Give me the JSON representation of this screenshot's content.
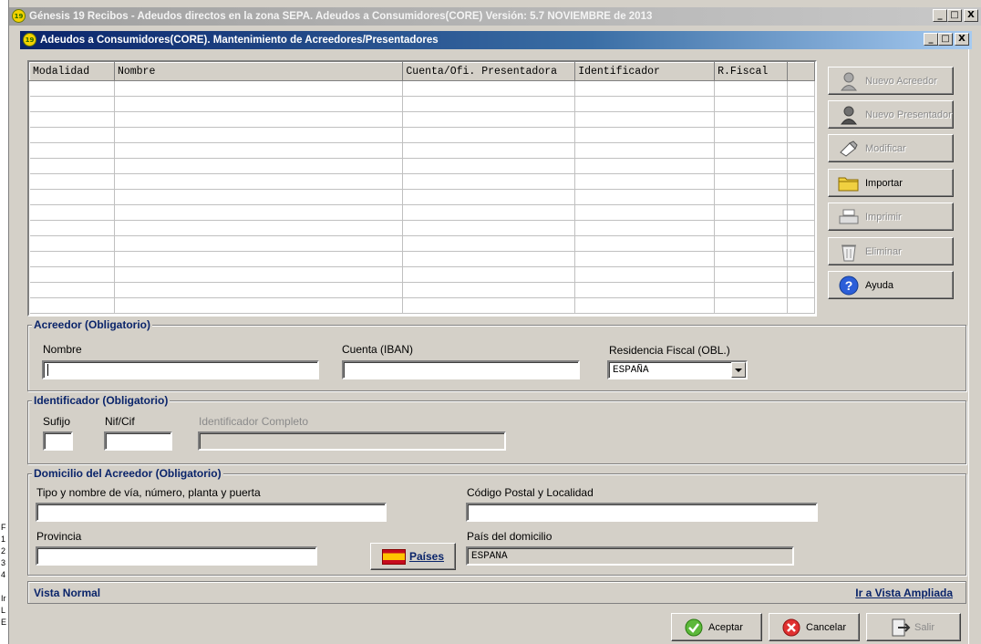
{
  "outer_window": {
    "title": "Génesis 19 Recibos - Adeudos directos en la zona SEPA. Adeudos a Consumidores(CORE) Versión: 5.7 NOVIEMBRE de 2013",
    "icon_text": "19",
    "min": "_",
    "max": "□",
    "close": "X"
  },
  "inner_window": {
    "title": "Adeudos a Consumidores(CORE). Mantenimiento de Acreedores/Presentadores",
    "icon_text": "19",
    "min": "_",
    "max": "□",
    "close": "X"
  },
  "grid": {
    "columns": [
      "Modalidad",
      "Nombre",
      "Cuenta/Ofi. Presentadora",
      "Identificador",
      "R.Fiscal",
      ""
    ]
  },
  "side_buttons": [
    {
      "label": "Nuevo Acreedor",
      "enabled": false,
      "icon": "person-icon"
    },
    {
      "label": "Nuevo Presentador",
      "enabled": false,
      "icon": "person-dark-icon"
    },
    {
      "label": "Modificar",
      "enabled": false,
      "icon": "edit-icon"
    },
    {
      "label": "Importar",
      "enabled": true,
      "icon": "folder-icon"
    },
    {
      "label": "Imprimir",
      "enabled": false,
      "icon": "printer-icon"
    },
    {
      "label": "Eliminar",
      "enabled": false,
      "icon": "trash-icon"
    },
    {
      "label": "Ayuda",
      "enabled": true,
      "icon": "help-icon"
    }
  ],
  "acreedor": {
    "title": "Acreedor (Obligatorio)",
    "nombre_label": "Nombre",
    "nombre_value": "",
    "cuenta_label": "Cuenta (IBAN)",
    "cuenta_value": "",
    "residencia_label": "Residencia Fiscal (OBL.)",
    "residencia_value": "ESPAÑA"
  },
  "identificador": {
    "title": "Identificador (Obligatorio)",
    "sufijo_label": "Sufijo",
    "nif_label": "Nif/Cif",
    "completo_label": "Identificador Completo"
  },
  "domicilio": {
    "title": "Domicilio del Acreedor (Obligatorio)",
    "via_label": "Tipo y nombre de vía, número, planta y puerta",
    "cp_label": "Código Postal y Localidad",
    "provincia_label": "Provincia",
    "paises_button": "Países",
    "pais_label": "País del domicilio",
    "pais_value": "ESPANA"
  },
  "status": {
    "left": "Vista Normal",
    "right": "Ir a Vista Ampliada"
  },
  "footer_buttons": {
    "aceptar": "Aceptar",
    "cancelar": "Cancelar",
    "salir": "Salir"
  },
  "left_strip_text": [
    "F",
    "1",
    "2",
    "3",
    "4",
    "",
    "Ir",
    "L",
    "E"
  ],
  "colors": {
    "group_title": "#0a246a",
    "titlebar_active": "#0a246a",
    "background": "#d4d0c8"
  }
}
